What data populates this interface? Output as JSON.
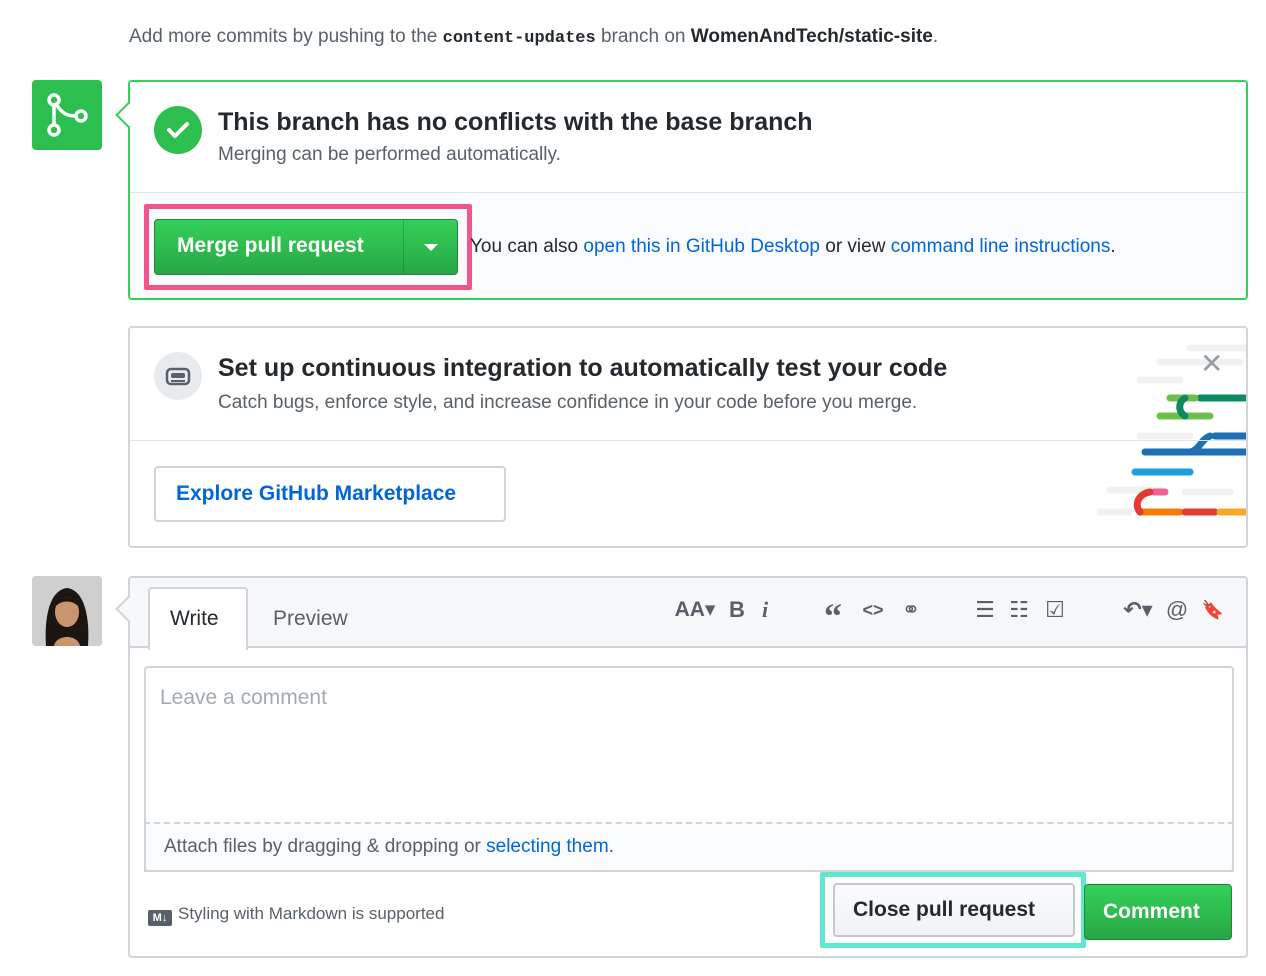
{
  "top_note": {
    "prefix": "Add more commits by pushing to the",
    "branch": "content-updates",
    "middle": "branch on",
    "repo": "WomenAndTech/static-site",
    "suffix": "."
  },
  "merge": {
    "title": "This branch has no conflicts with the base branch",
    "subtitle": "Merging can be performed automatically.",
    "merge_button": "Merge pull request",
    "also_prefix": "You can also",
    "desktop_link": "open this in GitHub Desktop",
    "also_middle": "or view",
    "cli_link": "command line instructions",
    "also_suffix": "."
  },
  "ci": {
    "title": "Set up continuous integration to automatically test your code",
    "subtitle": "Catch bugs, enforce style, and increase confidence in your code before you merge.",
    "explore_button": "Explore GitHub Marketplace",
    "close_glyph": "✕"
  },
  "comment": {
    "tabs": {
      "write": "Write",
      "preview": "Preview"
    },
    "toolbar": {
      "header": "AA▾",
      "bold": "B",
      "italic": "i",
      "quote": "“",
      "code": "<>",
      "link": "⚭",
      "bullets": "☰",
      "numbered": "☷",
      "tasks": "☑",
      "reply": "↶▾",
      "mention": "@",
      "bookmark": "🔖"
    },
    "placeholder": "Leave a comment",
    "attach_prefix": "Attach files by dragging & dropping or",
    "attach_link": "selecting them",
    "attach_suffix": ".",
    "markdown_badge": "M↓",
    "markdown_note": "Styling with Markdown is supported",
    "close_button": "Close pull request",
    "comment_button": "Comment"
  },
  "colors": {
    "success": "#2cbe4e",
    "link": "#0366d6",
    "merge_highlight": "#f0568a",
    "close_highlight": "#5fe7d0"
  }
}
